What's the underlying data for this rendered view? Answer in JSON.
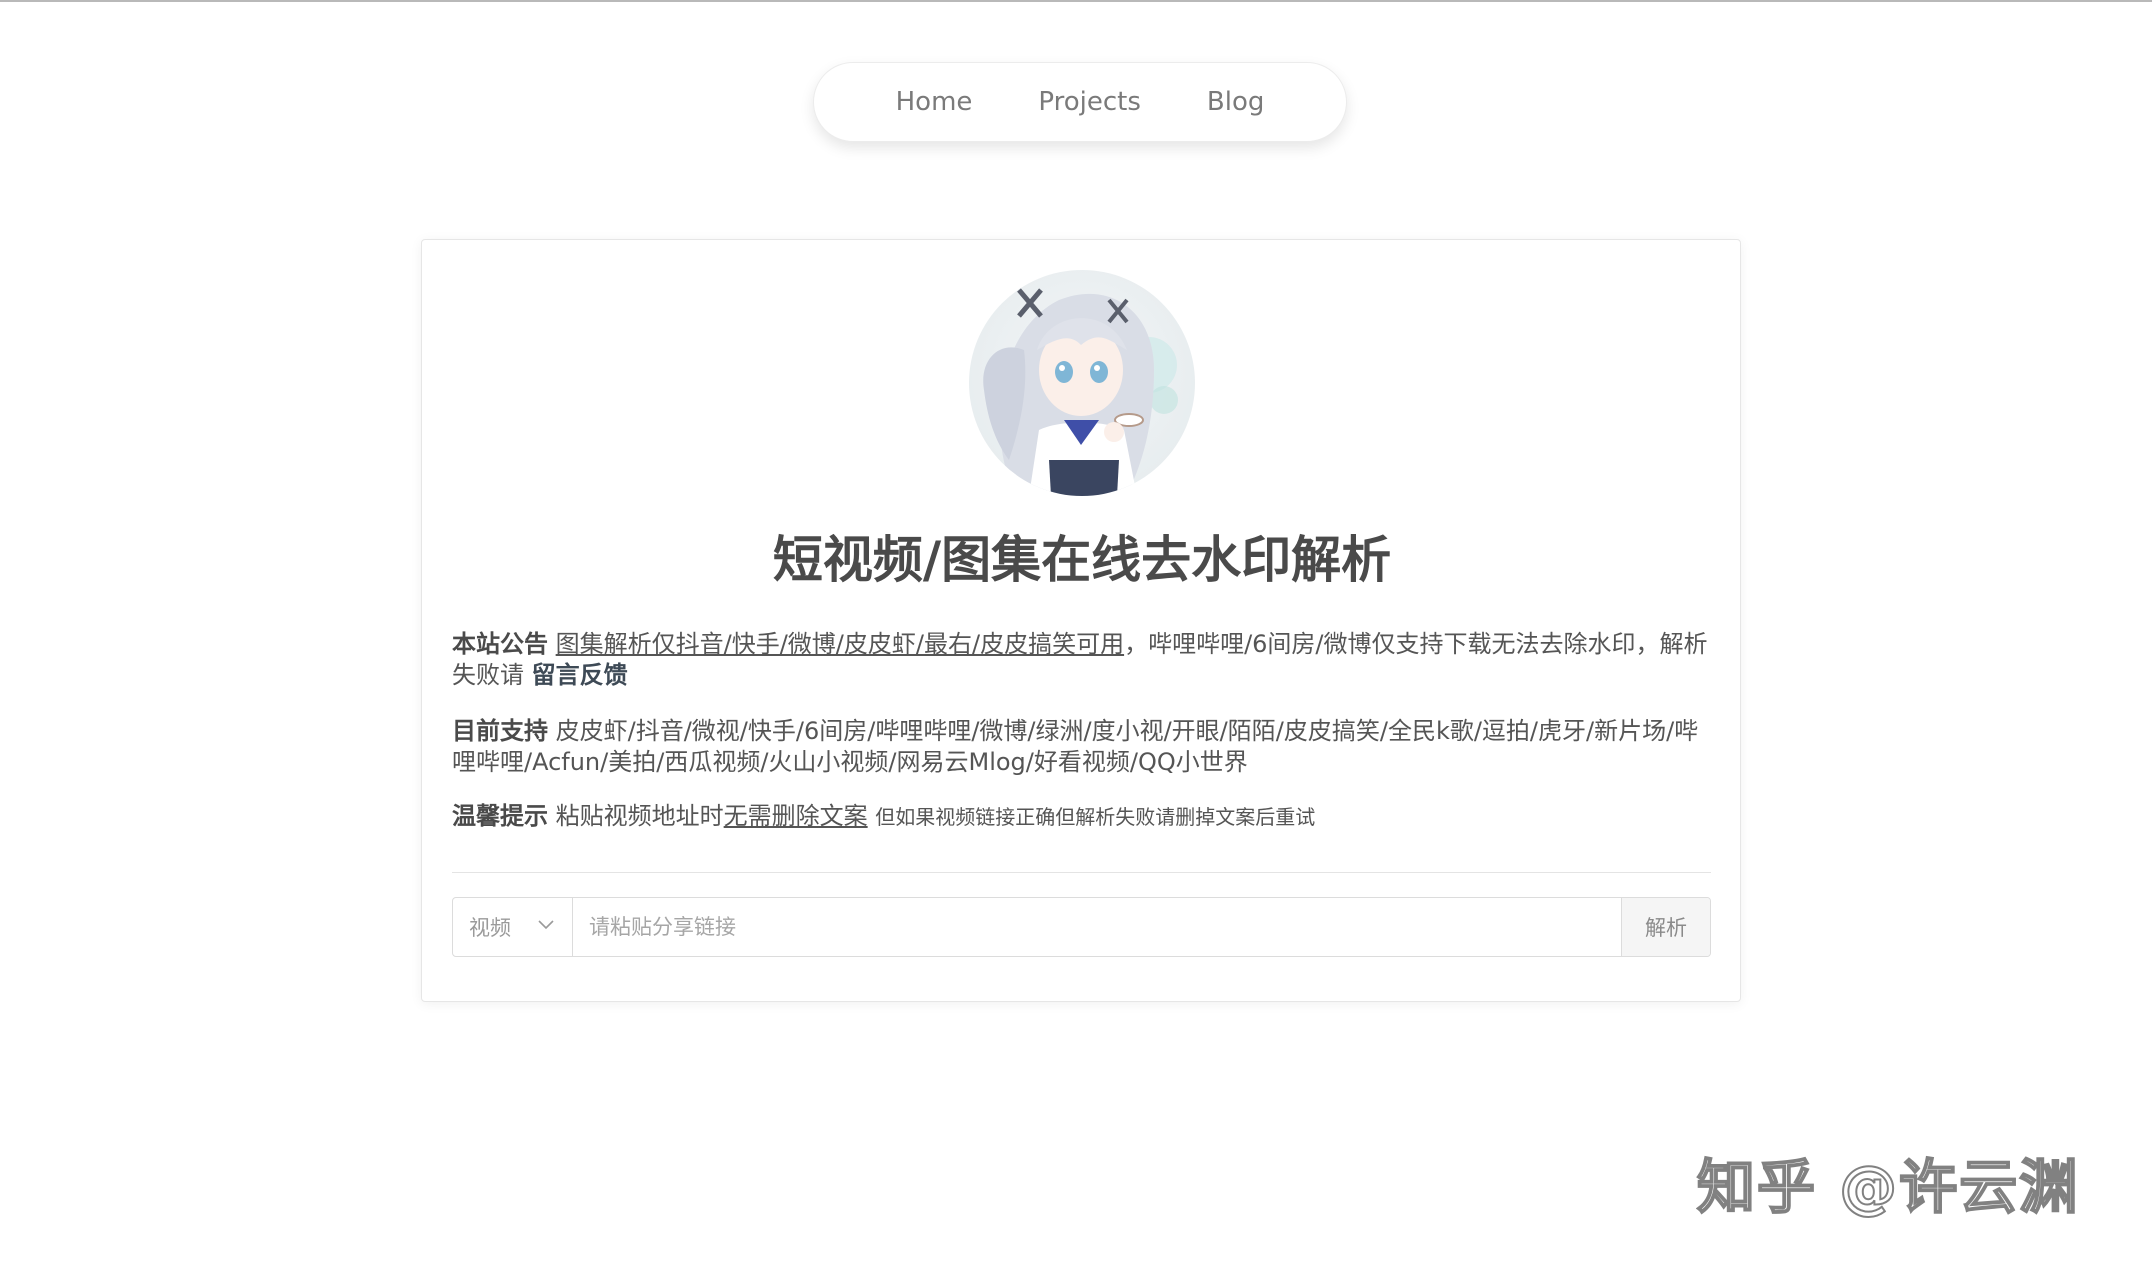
{
  "nav": {
    "items": [
      {
        "label": "Home"
      },
      {
        "label": "Projects"
      },
      {
        "label": "Blog"
      }
    ]
  },
  "card": {
    "title": "短视频/图集在线去水印解析",
    "announcement": {
      "lead": "本站公告",
      "link": "图集解析仅抖音/快手/微博/皮皮虾/最右/皮皮搞笑可用",
      "text": "，哔哩哔哩/6间房/微博仅支持下载无法去除水印，解析失败请",
      "feedback": "留言反馈"
    },
    "support": {
      "lead": "目前支持",
      "text": "皮皮虾/抖音/微视/快手/6间房/哔哩哔哩/微博/绿洲/度小视/开眼/陌陌/皮皮搞笑/全民k歌/逗拍/虎牙/新片场/哔哩哔哩/Acfun/美拍/西瓜视频/火山小视频/网易云Mlog/好看视频/QQ小世界"
    },
    "tip": {
      "lead": "温馨提示",
      "text": "粘贴视频地址时",
      "underlined": "无需删除文案",
      "small": "但如果视频链接正确但解析失败请删掉文案后重试"
    },
    "form": {
      "type_selected": "视频",
      "placeholder": "请粘贴分享链接",
      "value": "",
      "submit": "解析"
    }
  },
  "watermark": "知乎 @许云渊",
  "colors": {
    "accent": "#3e4a56",
    "text": "#4a4a4a"
  }
}
